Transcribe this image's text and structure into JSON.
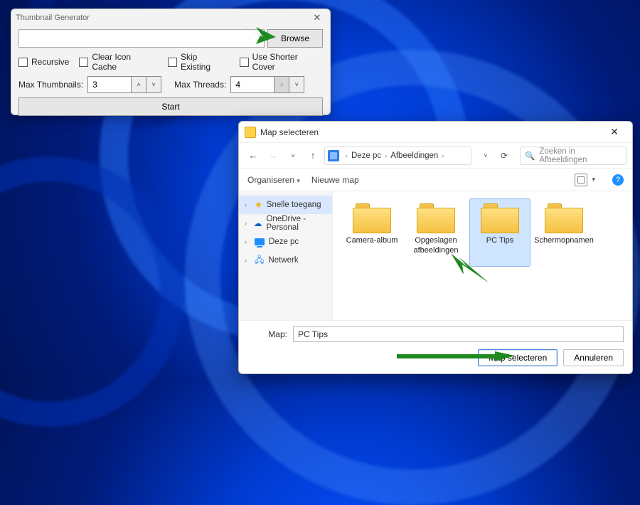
{
  "thumbnail_window": {
    "title": "Thumbnail Generator",
    "path": "",
    "browse_label": "Browse",
    "checkboxes": {
      "recursive": "Recursive",
      "clear_cache": "Clear Icon Cache",
      "skip_existing": "Skip Existing",
      "shorter_cover": "Use Shorter Cover"
    },
    "max_thumbnails_label": "Max Thumbnails:",
    "max_thumbnails_value": "3",
    "max_threads_label": "Max Threads:",
    "max_threads_value": "4",
    "start_label": "Start"
  },
  "folder_dialog": {
    "title": "Map selecteren",
    "breadcrumb": {
      "root": "Deze pc",
      "sub": "Afbeeldingen"
    },
    "search_placeholder": "Zoeken in Afbeeldingen",
    "toolbar": {
      "organize": "Organiseren",
      "new_folder": "Nieuwe map"
    },
    "sidebar": {
      "quick_access": "Snelle toegang",
      "onedrive": "OneDrive - Personal",
      "this_pc": "Deze pc",
      "network": "Netwerk"
    },
    "folders": [
      {
        "label": "Camera-album",
        "selected": false
      },
      {
        "label": "Opgeslagen afbeeldingen",
        "selected": false
      },
      {
        "label": "PC Tips",
        "selected": true
      },
      {
        "label": "Schermopnamen",
        "selected": false
      }
    ],
    "map_label": "Map:",
    "map_value": "PC Tips",
    "select_button": "Map selecteren",
    "cancel_button": "Annuleren"
  }
}
